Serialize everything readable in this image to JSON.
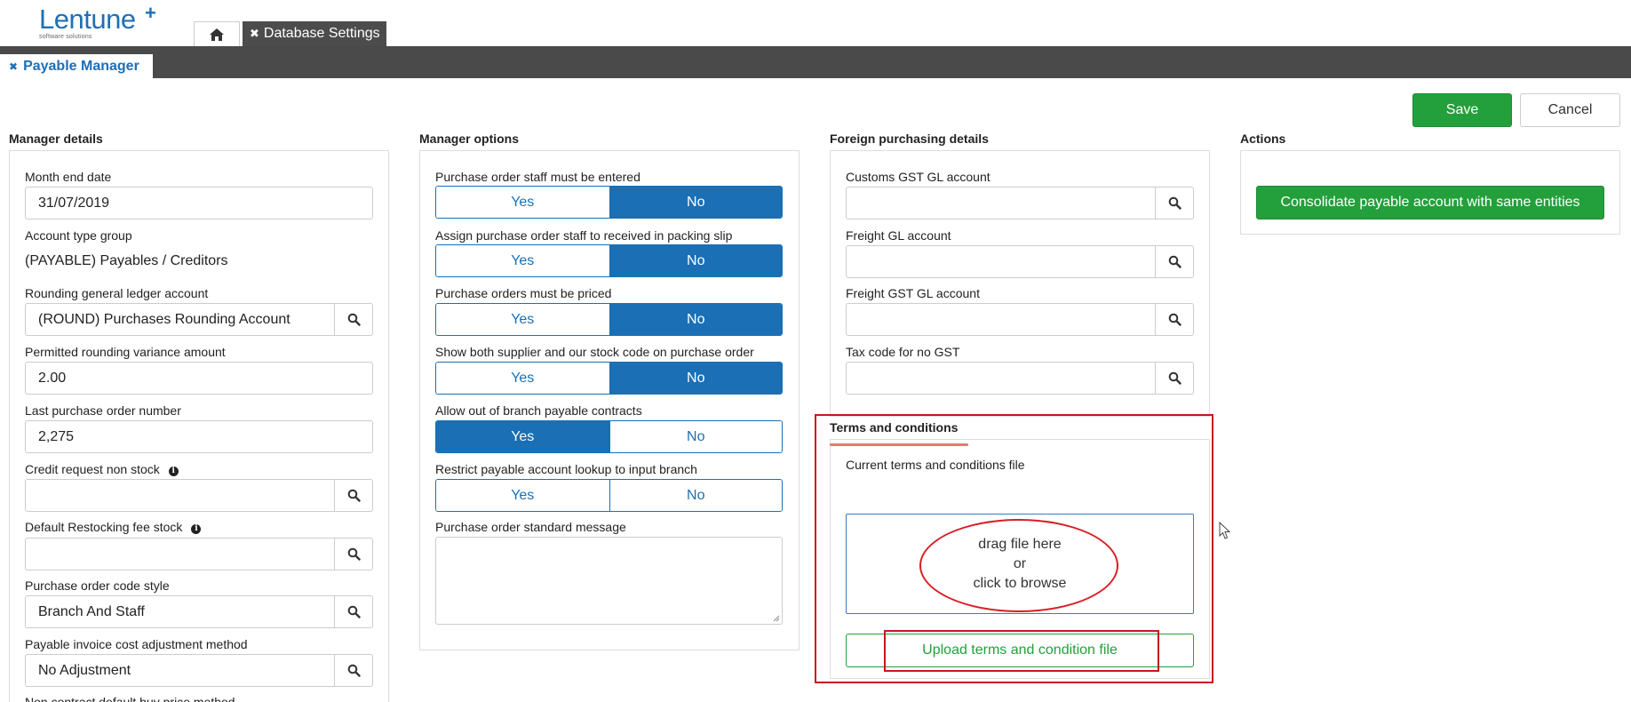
{
  "logo": {
    "name": "Lentune",
    "sub": "software solutions"
  },
  "tabs": {
    "database_settings": "Database Settings"
  },
  "sub_tab": {
    "label": "Payable Manager"
  },
  "buttons": {
    "save": "Save",
    "cancel": "Cancel"
  },
  "manager_details": {
    "title": "Manager details",
    "month_end_label": "Month end date",
    "month_end_value": "31/07/2019",
    "account_type_label": "Account type group",
    "account_type_value": "(PAYABLE) Payables / Creditors",
    "rounding_label": "Rounding general ledger account",
    "rounding_value": "(ROUND) Purchases Rounding Account",
    "variance_label": "Permitted rounding variance amount",
    "variance_value": "2.00",
    "last_po_label": "Last purchase order number",
    "last_po_value": "2,275",
    "credit_label": "Credit request non stock",
    "restock_label": "Default Restocking fee stock",
    "po_code_label": "Purchase order code style",
    "po_code_value": "Branch And Staff",
    "cost_adj_label": "Payable invoice cost adjustment method",
    "cost_adj_value": "No Adjustment",
    "next_label": "Non contract default buy price method"
  },
  "manager_options": {
    "title": "Manager options",
    "yes": "Yes",
    "no": "No",
    "opt1": "Purchase order staff must be entered",
    "opt2": "Assign purchase order staff to received in packing slip",
    "opt3": "Purchase orders must be priced",
    "opt4": "Show both supplier and our stock code on purchase order",
    "opt5": "Allow out of branch payable contracts",
    "opt6": "Restrict payable account lookup to input branch",
    "message_label": "Purchase order standard message"
  },
  "foreign": {
    "title": "Foreign purchasing details",
    "customs_label": "Customs GST GL account",
    "freight_label": "Freight GL account",
    "freight_gst_label": "Freight GST GL account",
    "tax_label": "Tax code for no GST"
  },
  "terms": {
    "title": "Terms and conditions",
    "current_label": "Current terms and conditions file",
    "drop_line1": "drag file here",
    "drop_line2": "or",
    "drop_line3": "click to browse",
    "upload_label": "Upload terms and condition file"
  },
  "actions": {
    "title": "Actions",
    "consolidate_label": "Consolidate payable account with same entities"
  },
  "colors": {
    "primary": "#1a6fb5",
    "success": "#23a03b",
    "header": "#4a4a4a",
    "annotation": "#c9151e"
  }
}
